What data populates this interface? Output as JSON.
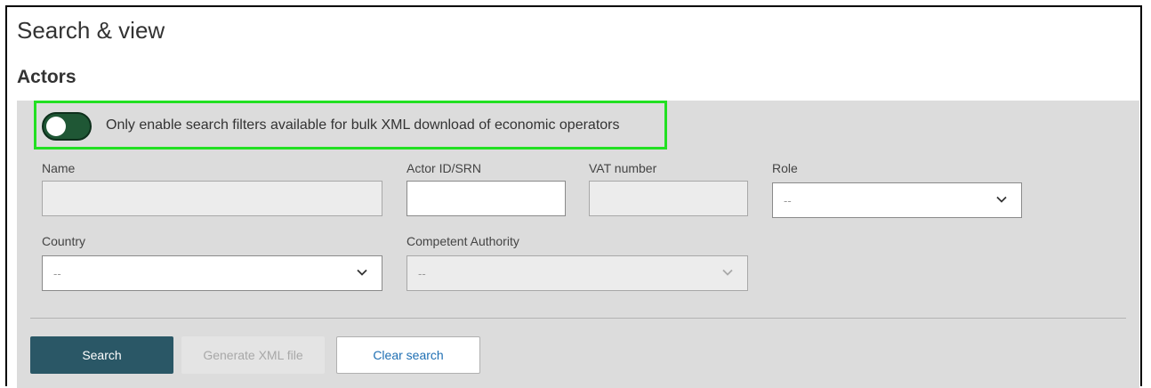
{
  "header": {
    "title": "Search & view",
    "section": "Actors"
  },
  "filter_toggle": {
    "label": "Only enable search filters available for bulk XML download of economic operators",
    "checked": true,
    "color": "#1f5735",
    "highlight_color": "#22e022"
  },
  "fields": {
    "name": {
      "label": "Name",
      "value": "",
      "disabled": true
    },
    "actor_id": {
      "label": "Actor ID/SRN",
      "value": ""
    },
    "vat": {
      "label": "VAT number",
      "value": "",
      "disabled": true
    },
    "role": {
      "label": "Role",
      "selected": "--"
    },
    "country": {
      "label": "Country",
      "selected": "--"
    },
    "authority": {
      "label": "Competent Authority",
      "selected": "--",
      "disabled": true
    }
  },
  "buttons": {
    "search": "Search",
    "generate_xml": "Generate XML file",
    "clear": "Clear search"
  },
  "icons": {
    "select_arrow": "chevron-down-icon"
  },
  "colors": {
    "primary": "#2a5766",
    "link": "#1f6fb3",
    "panel": "#dcdcdc"
  }
}
